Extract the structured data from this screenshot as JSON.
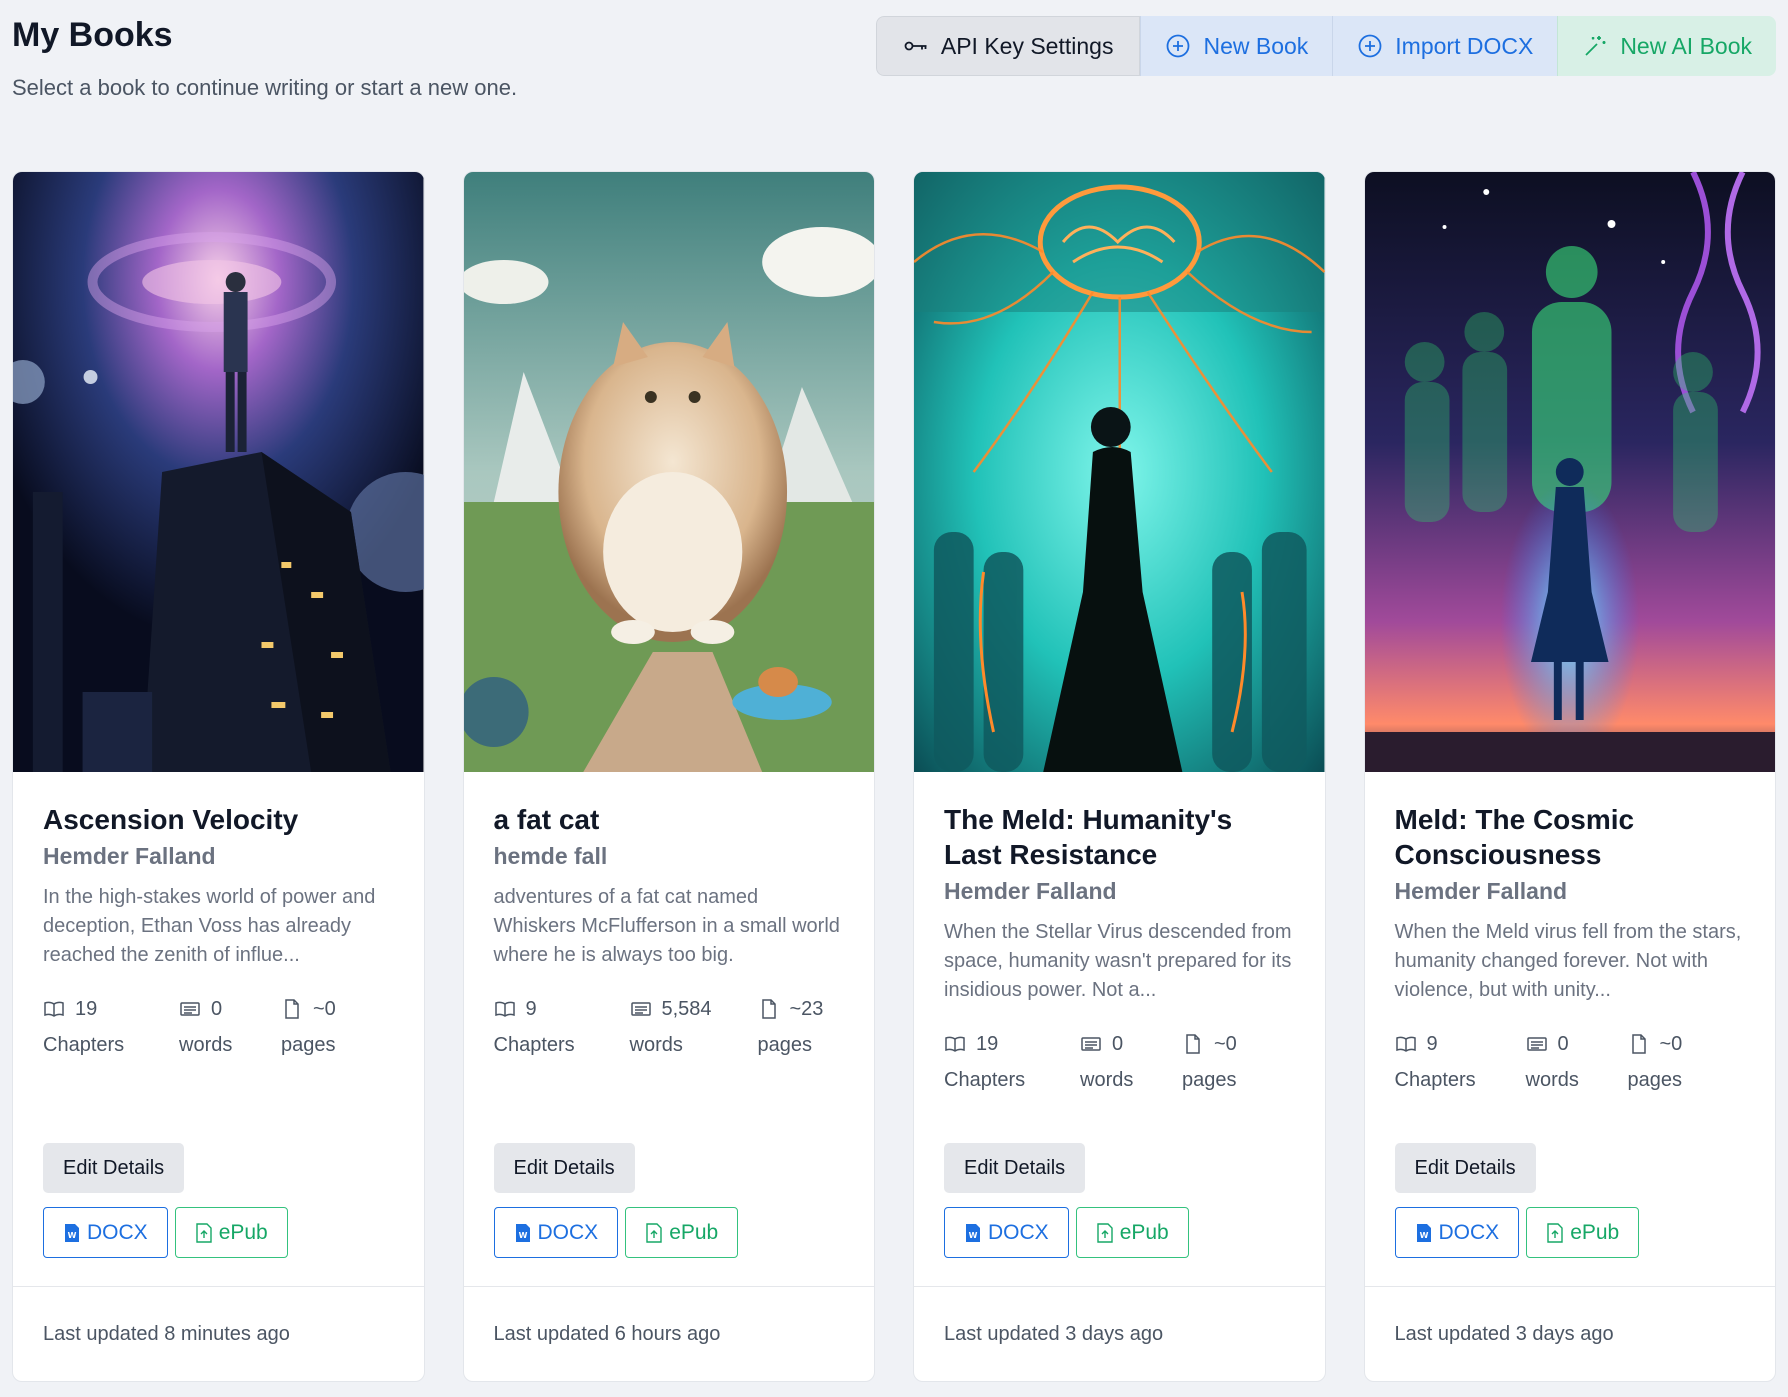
{
  "header": {
    "title": "My Books",
    "subtitle": "Select a book to continue writing or start a new one."
  },
  "toolbar": {
    "api_key_label": "API Key Settings",
    "new_book_label": "New Book",
    "import_docx_label": "Import DOCX",
    "new_ai_book_label": "New AI Book"
  },
  "labels": {
    "chapters": "Chapters",
    "words": "words",
    "pages": "pages",
    "edit_details": "Edit Details",
    "docx": "DOCX",
    "epub": "ePub"
  },
  "books": [
    {
      "title": "Ascension Velocity",
      "author": "Hemder Falland",
      "description": "In the high-stakes world of power and deception, Ethan Voss has already reached the zenith of influe...",
      "chapters": "19",
      "words": "0",
      "pages": "~0",
      "updated": "Last updated 8 minutes ago"
    },
    {
      "title": "a fat cat",
      "author": "hemde fall",
      "description": "adventures of a fat cat named Whiskers McFlufferson in a small world where he is always too big.",
      "chapters": "9",
      "words": "5,584",
      "pages": "~23",
      "updated": "Last updated 6 hours ago"
    },
    {
      "title": "The Meld: Humanity's Last Resistance",
      "author": "Hemder Falland",
      "description": "When the Stellar Virus descended from space, humanity wasn't prepared for its insidious power. Not a...",
      "chapters": "19",
      "words": "0",
      "pages": "~0",
      "updated": "Last updated 3 days ago"
    },
    {
      "title": "Meld: The Cosmic Consciousness",
      "author": "Hemder Falland",
      "description": "When the Meld virus fell from the stars, humanity changed forever. Not with violence, but with unity...",
      "chapters": "9",
      "words": "0",
      "pages": "~0",
      "updated": "Last updated 3 days ago"
    }
  ],
  "colors": {
    "primary": "#1d6fe0",
    "success": "#16a766",
    "background": "#f0f2f6"
  }
}
